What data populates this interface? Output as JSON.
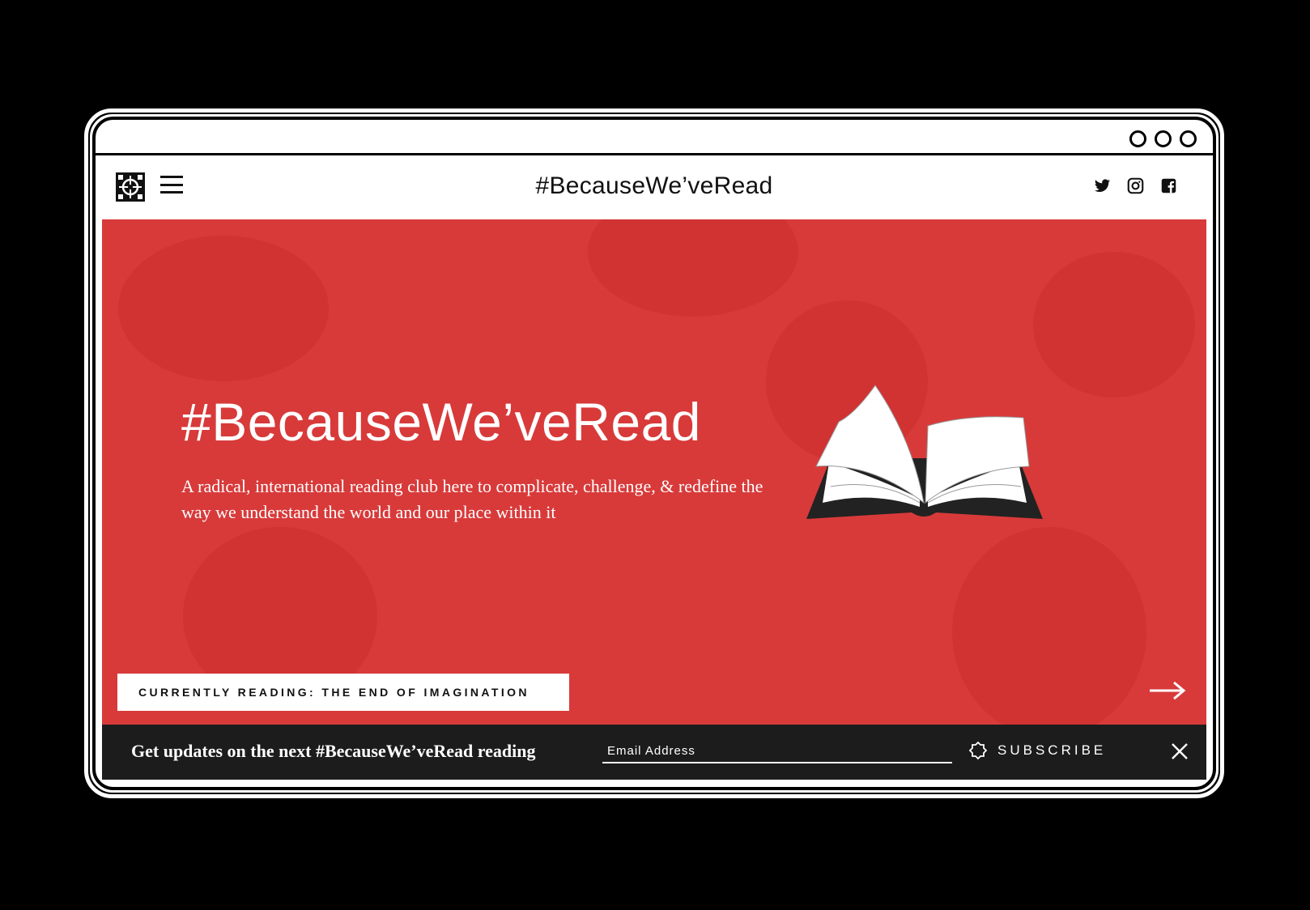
{
  "window": {
    "controls": [
      "circle",
      "circle",
      "circle"
    ]
  },
  "nav": {
    "site_title": "#BecauseWe’veRead",
    "social": [
      "twitter-icon",
      "instagram-icon",
      "facebook-icon"
    ]
  },
  "hero": {
    "title": "#BecauseWe’veRead",
    "subtitle": "A radical, international reading club here to complicate, challenge, & redefine the way we understand the world and our place within it",
    "currently_reading": "CURRENTLY READING: THE END OF IMAGINATION",
    "bg_color": "#d83a3a"
  },
  "signup": {
    "prompt": "Get updates on the next #BecauseWe’veRead reading",
    "email_placeholder": "Email Address",
    "subscribe_label": "SUBSCRIBE"
  }
}
